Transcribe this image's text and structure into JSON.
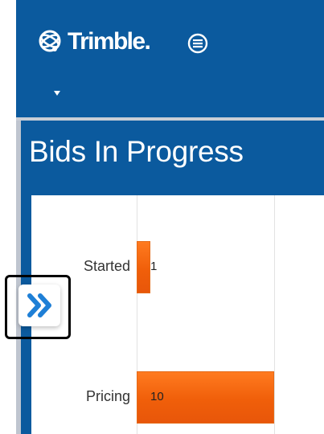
{
  "header": {
    "logo_text": "Trimble.",
    "logo_icon": "trimble-globe-icon",
    "menu_icon": "hamburger-menu-icon",
    "dropdown_icon": "caret-down-icon",
    "background_color": "#0b5a9e"
  },
  "panel": {
    "title": "Bids In Progress"
  },
  "expand_button": {
    "icon": "double-chevron-right-icon",
    "icon_color": "#1e7fd6"
  },
  "chart_data": {
    "type": "bar",
    "orientation": "horizontal",
    "categories": [
      "Started",
      "Pricing"
    ],
    "values": [
      1,
      10
    ],
    "xlim": [
      0,
      20
    ],
    "grid": true,
    "bar_color": "#f26a10"
  }
}
